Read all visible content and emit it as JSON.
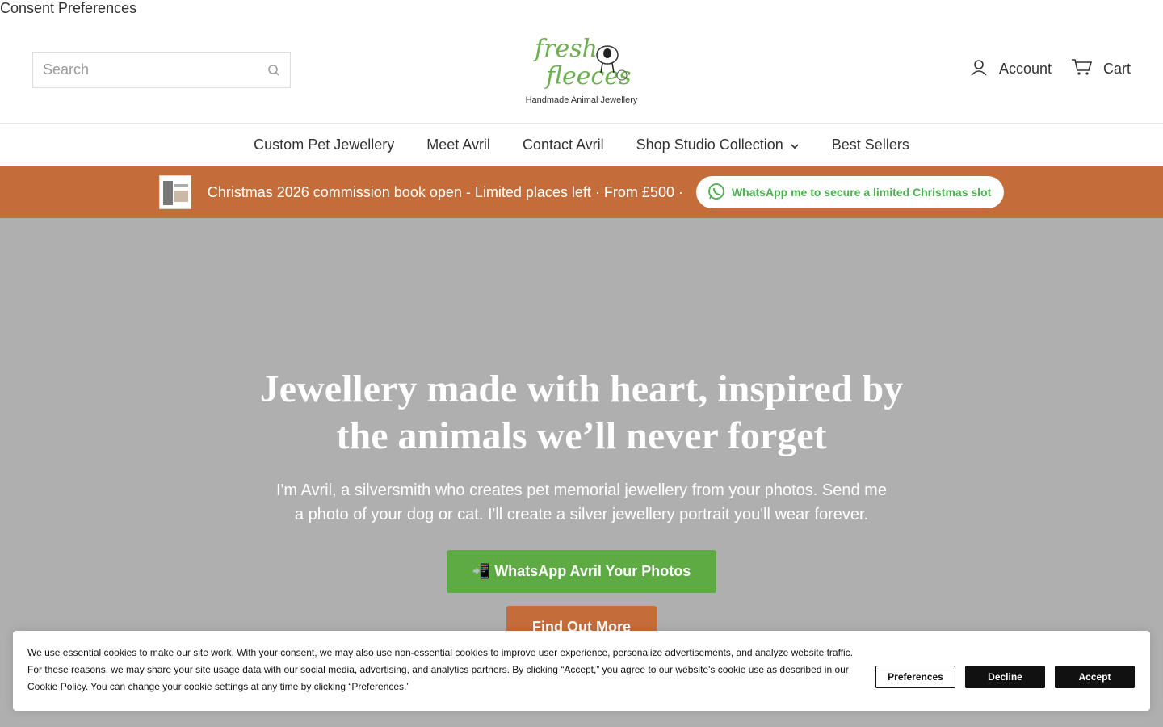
{
  "consent_link": "Consent Preferences",
  "search": {
    "placeholder": "Search"
  },
  "logo": {
    "brand_line1": "fresh",
    "brand_line2": "fleeces",
    "tagline": "Handmade Animal Jewellery"
  },
  "header": {
    "account_label": "Account",
    "cart_label": "Cart"
  },
  "nav": {
    "items": [
      {
        "label": "Custom Pet Jewellery"
      },
      {
        "label": "Meet Avril"
      },
      {
        "label": "Contact Avril"
      },
      {
        "label": "Shop Studio Collection",
        "has_dropdown": true
      },
      {
        "label": "Best Sellers"
      }
    ]
  },
  "promo": {
    "text": "Christmas 2026 commission book open - Limited places left · From £500 ·",
    "button_label": "WhatsApp me to secure a limited Christmas slot",
    "bg_color": "#c46d3a"
  },
  "hero": {
    "title_line1": "Jewellery made with heart, inspired by",
    "title_line2": "the animals we’ll never forget",
    "subtitle_line1": "I'm Avril, a silversmith who creates pet memorial jewellery from your photos. Send me",
    "subtitle_line2": "a photo of your dog or cat. I'll create a silver jewellery portrait you'll wear forever.",
    "primary_button": "📲 WhatsApp Avril Your Photos",
    "secondary_button": "Find Out More",
    "primary_color": "#5eab44",
    "secondary_color": "#c46d3a"
  },
  "cookie": {
    "text_part1": "We use essential cookies to make our site work. With your consent, we may also use non-essential cookies to improve user experience, personalize advertisements, and analyze website traffic. For these reasons, we may share your site usage data with our social media, advertising, and analytics partners. By clicking “Accept,” you agree to our website's cookie use as described in our ",
    "policy_link": "Cookie Policy",
    "text_part2": ". You can change your cookie settings at any time by clicking “",
    "preferences_link": "Preferences",
    "text_part3": ".”",
    "buttons": {
      "preferences": "Preferences",
      "decline": "Decline",
      "accept": "Accept"
    }
  }
}
